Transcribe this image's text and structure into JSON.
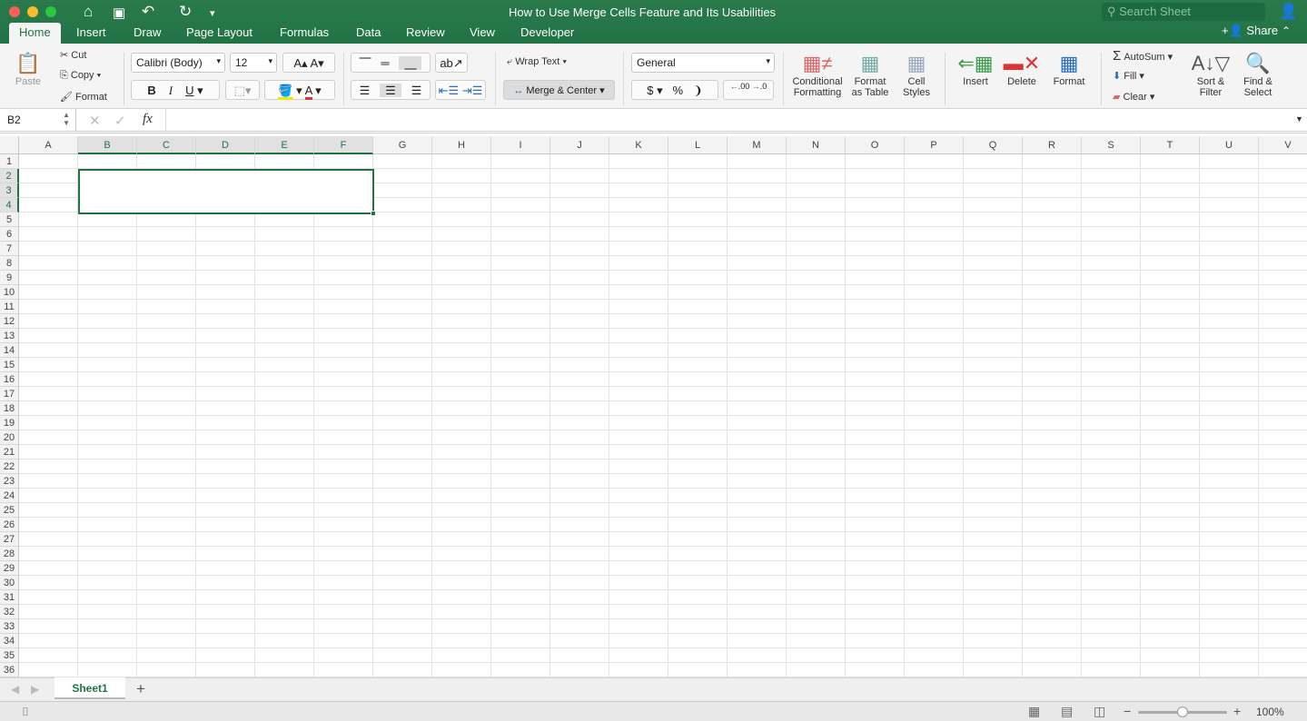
{
  "window": {
    "title": "How to Use Merge Cells Feature and Its Usabilities",
    "search_placeholder": "Search Sheet",
    "share": "Share"
  },
  "tabs": [
    "Home",
    "Insert",
    "Draw",
    "Page Layout",
    "Formulas",
    "Data",
    "Review",
    "View",
    "Developer"
  ],
  "clipboard": {
    "paste": "Paste",
    "cut": "Cut",
    "copy": "Copy",
    "format": "Format"
  },
  "font": {
    "name": "Calibri (Body)",
    "size": "12",
    "bold": "B",
    "italic": "I",
    "underline": "U"
  },
  "alignment": {
    "wrap_text": "Wrap Text",
    "merge_center": "Merge & Center"
  },
  "number": {
    "format": "General",
    "currency": "$",
    "percent": "%",
    "comma": "❩",
    "inc_decimal": ".00",
    "dec_decimal": ".0"
  },
  "styles": {
    "conditional": "Conditional",
    "conditional2": "Formatting",
    "format_table": "Format",
    "format_table2": "as Table",
    "cell_styles": "Cell",
    "cell_styles2": "Styles"
  },
  "cells_group": {
    "insert": "Insert",
    "delete": "Delete",
    "format": "Format"
  },
  "editing": {
    "autosum": "AutoSum",
    "fill": "Fill",
    "clear": "Clear",
    "sort": "Sort &",
    "sort2": "Filter",
    "find": "Find &",
    "find2": "Select"
  },
  "formula_bar": {
    "name_box": "B2",
    "fx": "fx",
    "value": ""
  },
  "columns": [
    "A",
    "B",
    "C",
    "D",
    "E",
    "F",
    "G",
    "H",
    "I",
    "J",
    "K",
    "L",
    "M",
    "N",
    "O",
    "P",
    "Q",
    "R",
    "S",
    "T",
    "U",
    "V"
  ],
  "rows": [
    "1",
    "2",
    "3",
    "4",
    "5",
    "6",
    "7",
    "8",
    "9",
    "10",
    "11",
    "12",
    "13",
    "14",
    "15",
    "16",
    "17",
    "18",
    "19",
    "20",
    "21",
    "22",
    "23",
    "24",
    "25",
    "26",
    "27",
    "28",
    "29",
    "30",
    "31",
    "32",
    "33",
    "34",
    "35",
    "36"
  ],
  "selection": {
    "merged_range": "B2:F4"
  },
  "sheets": [
    "Sheet1"
  ],
  "status": {
    "zoom": "100%",
    "zoom_level": 100
  },
  "colors": {
    "accent": "#217346"
  }
}
